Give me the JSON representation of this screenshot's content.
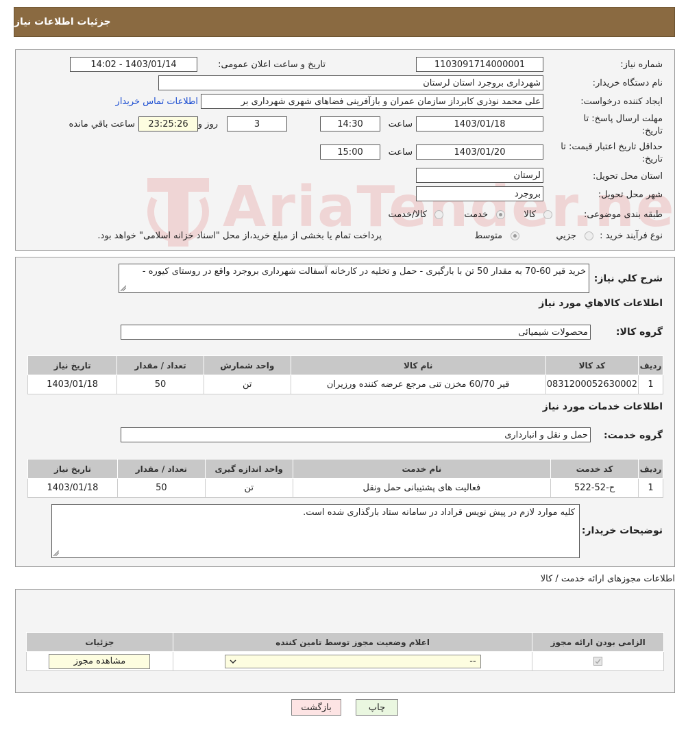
{
  "header": {
    "title": "جزئیات اطلاعات نیاز"
  },
  "fields": {
    "need_number_label": "شماره نیاز:",
    "need_number": "1103091714000001",
    "announce_label": "تاریخ و ساعت اعلان عمومی:",
    "announce_value": "1403/01/14 - 14:02",
    "buyer_org_label": "نام دستگاه خریدار:",
    "buyer_org": "شهرداری بروجرد استان لرستان",
    "creator_label": "ایجاد کننده درخواست:",
    "creator": "علی محمد نوذری کابرداز سازمان عمران و بازآفرینی فضاهای شهری شهرداری بر",
    "contact_link": "اطلاعات تماس خریدار",
    "deadline_label_1": "مهلت ارسال پاسخ: تا",
    "deadline_label_2": "تاریخ:",
    "deadline_date": "1403/01/18",
    "time_label": "ساعت",
    "deadline_time": "14:30",
    "days_value": "3",
    "days_label": "روز و",
    "remaining_time": "23:25:26",
    "remaining_label": "ساعت باقي مانده",
    "validity_label_1": "حداقل تاریخ اعتبار قیمت: تا",
    "validity_label_2": "تاریخ:",
    "validity_date": "1403/01/20",
    "validity_time": "15:00",
    "province_label": "استان محل تحویل:",
    "province": "لرستان",
    "city_label": "شهر محل تحویل:",
    "city": "بروجرد",
    "category_label": "طبقه بندی موضوعی:",
    "category_options": [
      "کالا",
      "خدمت",
      "کالا/خدمت"
    ],
    "process_label": "نوع فرآیند خرید :",
    "process_options": [
      "جزيي",
      "متوسط"
    ],
    "process_note": "پرداخت تمام یا بخشی از مبلغ خرید،از محل \"اسناد خزانه اسلامی\" خواهد بود."
  },
  "description": {
    "label": "شرح کلي نياز:",
    "text": "خرید قیر 60-70 به مقدار 50 تن با بارگیری - حمل و تخلیه در کارخانه آسفالت شهرداری بروجرد واقع در روستای کیوره -"
  },
  "goods": {
    "section_title": "اطلاعات کالاهاي مورد نياز",
    "group_label": "گروه کالا:",
    "group_value": "محصولات شیمیائی",
    "headers": [
      "رديف",
      "کد کالا",
      "نام کالا",
      "واحد شمارش",
      "تعداد / مقدار",
      "تاریخ نیاز"
    ],
    "rows": [
      [
        "1",
        "0831200052630002",
        "قیر 60/70 مخزن تنی مرجع عرضه کننده ورزیران",
        "تن",
        "50",
        "1403/01/18"
      ]
    ]
  },
  "services": {
    "section_title": "اطلاعات خدمات مورد نياز",
    "group_label": "گروه خدمت:",
    "group_value": "حمل و نقل و انبارداری",
    "headers": [
      "رديف",
      "کد خدمت",
      "نام خدمت",
      "واحد اندازه گیری",
      "تعداد / مقدار",
      "تاریخ نیاز"
    ],
    "rows": [
      [
        "1",
        "ح-52-522",
        "فعالیت های پشتیبانی حمل ونقل",
        "تن",
        "50",
        "1403/01/18"
      ]
    ]
  },
  "buyer_notes": {
    "label": "توضیحات خریدار:",
    "text": "کلیه موارد لازم در پیش نویس قراداد در سامانه ستاد بارگذاری شده است."
  },
  "permits": {
    "title": "اطلاعات مجوزهای ارائه خدمت / کالا",
    "headers": [
      "الزامی بودن ارائه مجوز",
      "اعلام وضعیت مجوز توسط تامین کننده",
      "جزئیات"
    ],
    "select_value": "--",
    "view_button": "مشاهده مجوز"
  },
  "buttons": {
    "print": "چاپ",
    "back": "بازگشت"
  },
  "watermark": "AriaTender.neT",
  "colors": {
    "header": "#8a6a41",
    "link": "#1a4cd1",
    "print_bg": "#eaf7e0",
    "back_bg": "#fde4e4"
  }
}
